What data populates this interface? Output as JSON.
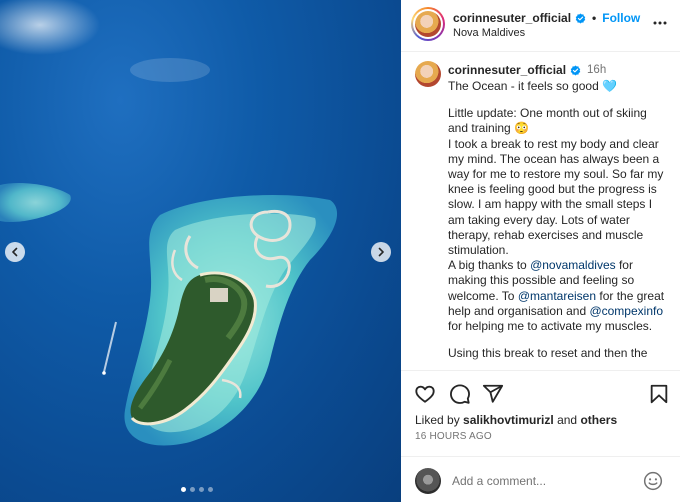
{
  "header": {
    "username": "corinnesuter_official",
    "follow_label": "Follow",
    "location": "Nova Maldives"
  },
  "caption": {
    "username": "corinnesuter_official",
    "time": "16h",
    "lines": {
      "l1": "The Ocean - it feels so good 🩵",
      "l2": "Little update: One month out of skiing and training 😳",
      "l3": "I took a break to rest my body and clear my mind. The ocean has always been a way for me to restore my soul. So far my knee is feeling good but the progress is slow. I am happy with the small steps I am taking every day. Lots of water therapy, rehab exercises and muscle stimulation.",
      "l4a": "A big thanks to ",
      "l4m": "@novamaldives",
      "l4b": " for making this possible and feeling so welcome. To ",
      "l4m2": "@mantareisen",
      "l4c": " for the great help and organisation and ",
      "l4m3": "@compexinfo",
      "l4d": " for helping me to activate my muscles.",
      "l5": "Using this break to reset and then the"
    }
  },
  "likes": {
    "prefix": "Liked by ",
    "user": "salikhovtimurizl",
    "middle": " and ",
    "others": "others"
  },
  "posted_ago": "16 HOURS AGO",
  "comment": {
    "placeholder": "Add a comment..."
  },
  "carousel": {
    "count": 4,
    "active_index": 0
  },
  "icons": {
    "like": "heart-icon",
    "comment": "comment-icon",
    "share": "share-icon",
    "save": "bookmark-icon",
    "emoji": "emoji-icon",
    "more": "more-options-icon",
    "verified": "verified-badge-icon"
  },
  "colors": {
    "accent": "#0095f6",
    "verified": "#0095f6",
    "mention": "#00376b",
    "muted": "#737373"
  }
}
